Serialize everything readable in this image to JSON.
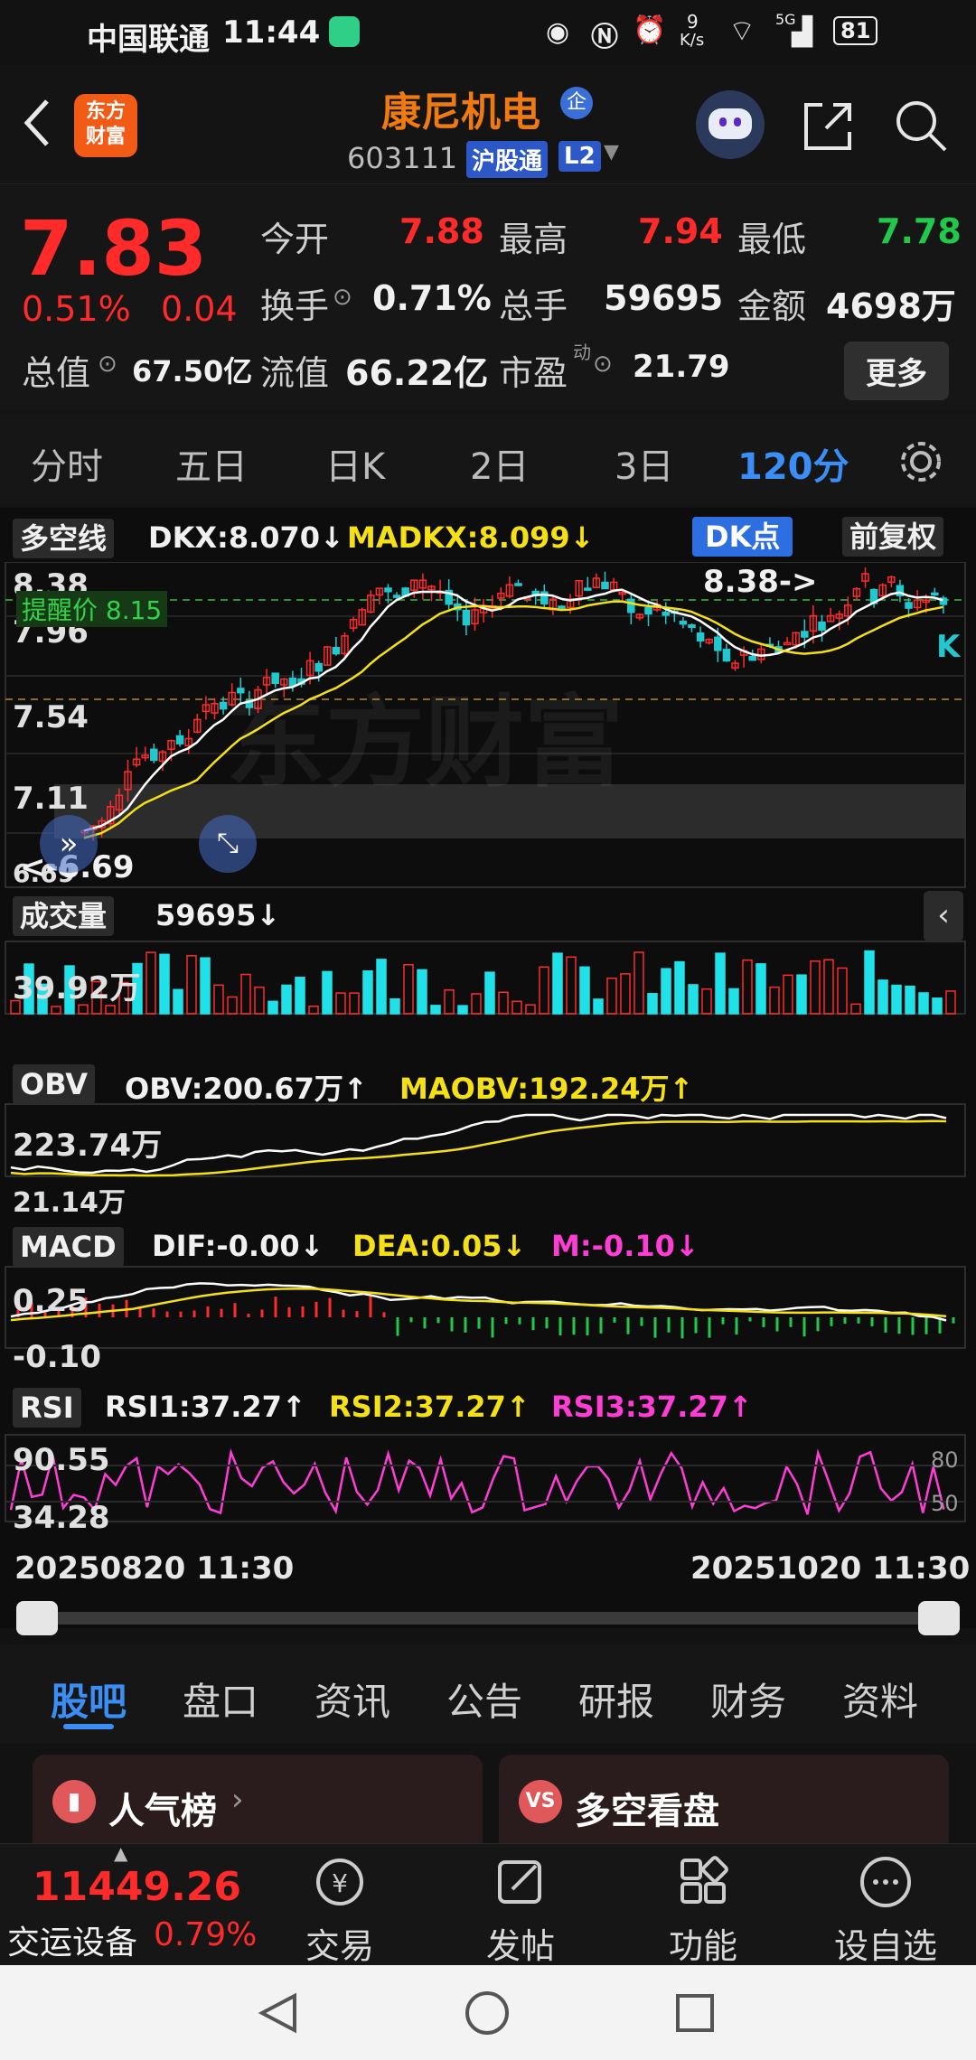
{
  "status_bar": {
    "carrier": "中国联通",
    "time": "11:44",
    "speed_top": "9",
    "speed_unit": "K/s",
    "net": "5G",
    "battery": "81"
  },
  "header": {
    "logo_line1": "东方",
    "logo_line2": "财富",
    "stock_name": "康尼机电",
    "badge": "企",
    "stock_code": "603111",
    "market_tag": "沪股通",
    "level_tag": "L2"
  },
  "quote": {
    "price": "7.83",
    "pct": "0.51%",
    "change": "0.04",
    "open_label": "今开",
    "open": "7.88",
    "high_label": "最高",
    "high": "7.94",
    "low_label": "最低",
    "low": "7.78",
    "turnover_label": "换手",
    "turnover": "0.71%",
    "volume_label": "总手",
    "volume": "59695",
    "amount_label": "金额",
    "amount": "4698万",
    "mktcap_label": "总值",
    "mktcap": "67.50亿",
    "float_label": "流值",
    "float": "66.22亿",
    "pe_label": "市盈",
    "pe_sup": "动",
    "pe": "21.79",
    "more": "更多"
  },
  "periods": [
    "分时",
    "五日",
    "日K",
    "2日",
    "3日",
    "120分"
  ],
  "main_chart": {
    "indicator": "多空线",
    "dkx_label": "DKX:8.070↓",
    "madkx_label": "MADKX:8.099↓",
    "dk_btn": "DK点",
    "fq_btn": "前复权",
    "alert": "提醒价 8.15",
    "y_ticks": [
      "8.38",
      "7.96",
      "7.54",
      "7.11",
      "6.69"
    ],
    "max_marker": "8.38->",
    "min_marker": "<-6.69",
    "k_marker": "K",
    "watermark": "东方财富"
  },
  "volume": {
    "indicator": "成交量",
    "value": "59695↓",
    "tick": "39.92万"
  },
  "obv": {
    "indicator": "OBV",
    "obv": "OBV:200.67万↑",
    "maobv": "MAOBV:192.24万↑",
    "tick_top": "223.74万",
    "tick_bottom": "21.14万"
  },
  "macd": {
    "indicator": "MACD",
    "dif": "DIF:-0.00↓",
    "dea": "DEA:0.05↓",
    "m": "M:-0.10↓",
    "tick_top": "0.25",
    "tick_bottom": "-0.10"
  },
  "rsi": {
    "indicator": "RSI",
    "rsi1": "RSI1:37.27↑",
    "rsi2": "RSI2:37.27↑",
    "rsi3": "RSI3:37.27↑",
    "tick_top": "90.55",
    "tick_bottom": "34.28",
    "level_80": "80",
    "level_50": "50"
  },
  "x_range": {
    "start": "20250820 11:30",
    "end": "20251020 11:30"
  },
  "info_tabs": [
    "股吧",
    "盘口",
    "资讯",
    "公告",
    "研报",
    "财务",
    "资料"
  ],
  "cards": {
    "left": "人气榜",
    "right": "多空看盘"
  },
  "bottom_bar": {
    "index_value": "11449.26",
    "index_name": "交运设备",
    "index_pct": "0.79%",
    "items": [
      "交易",
      "发帖",
      "功能",
      "设自选"
    ]
  },
  "colors": {
    "up": "#ff2a2a",
    "down": "#20c94a",
    "accent": "#3a8ef6",
    "brand": "#f25b16"
  }
}
